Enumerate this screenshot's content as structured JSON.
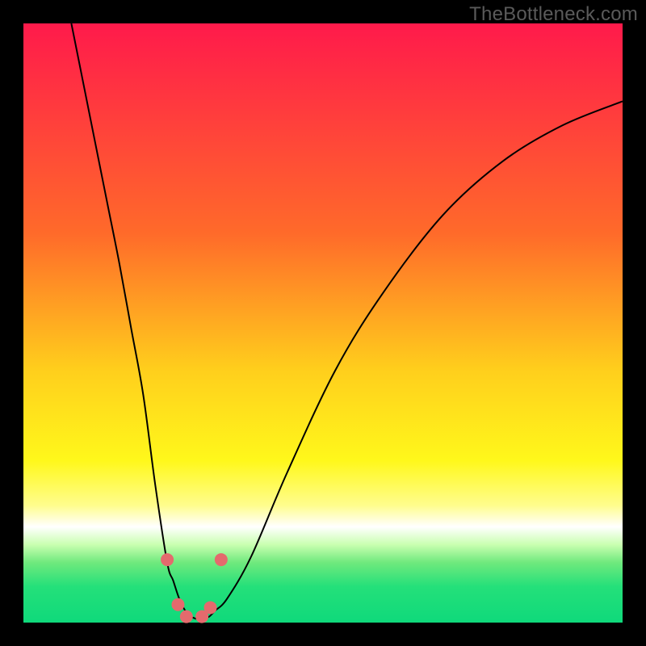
{
  "watermark": "TheBottleneck.com",
  "colors": {
    "marker": "#e46a6d",
    "curve": "#000000"
  },
  "chart_data": {
    "type": "line",
    "title": "",
    "xlabel": "",
    "ylabel": "",
    "xlim": [
      0,
      100
    ],
    "ylim": [
      0,
      100
    ],
    "series": [
      {
        "name": "curve",
        "x": [
          8,
          10,
          12,
          14,
          16,
          18,
          20,
          22,
          24,
          25,
          26,
          27,
          28,
          29,
          30,
          31,
          32,
          34,
          38,
          44,
          52,
          60,
          70,
          80,
          90,
          100
        ],
        "y": [
          100,
          90,
          80,
          70,
          60,
          49,
          38,
          23,
          10,
          7,
          4,
          2,
          1,
          0.6,
          0.6,
          1,
          2,
          4,
          11,
          25,
          42,
          55,
          68,
          77,
          83,
          87
        ]
      }
    ],
    "markers": [
      {
        "x": 24.0,
        "y": 10.5
      },
      {
        "x": 25.8,
        "y": 3.0
      },
      {
        "x": 27.2,
        "y": 1.0
      },
      {
        "x": 29.8,
        "y": 1.0
      },
      {
        "x": 31.2,
        "y": 2.5
      },
      {
        "x": 33.0,
        "y": 10.5
      }
    ]
  }
}
